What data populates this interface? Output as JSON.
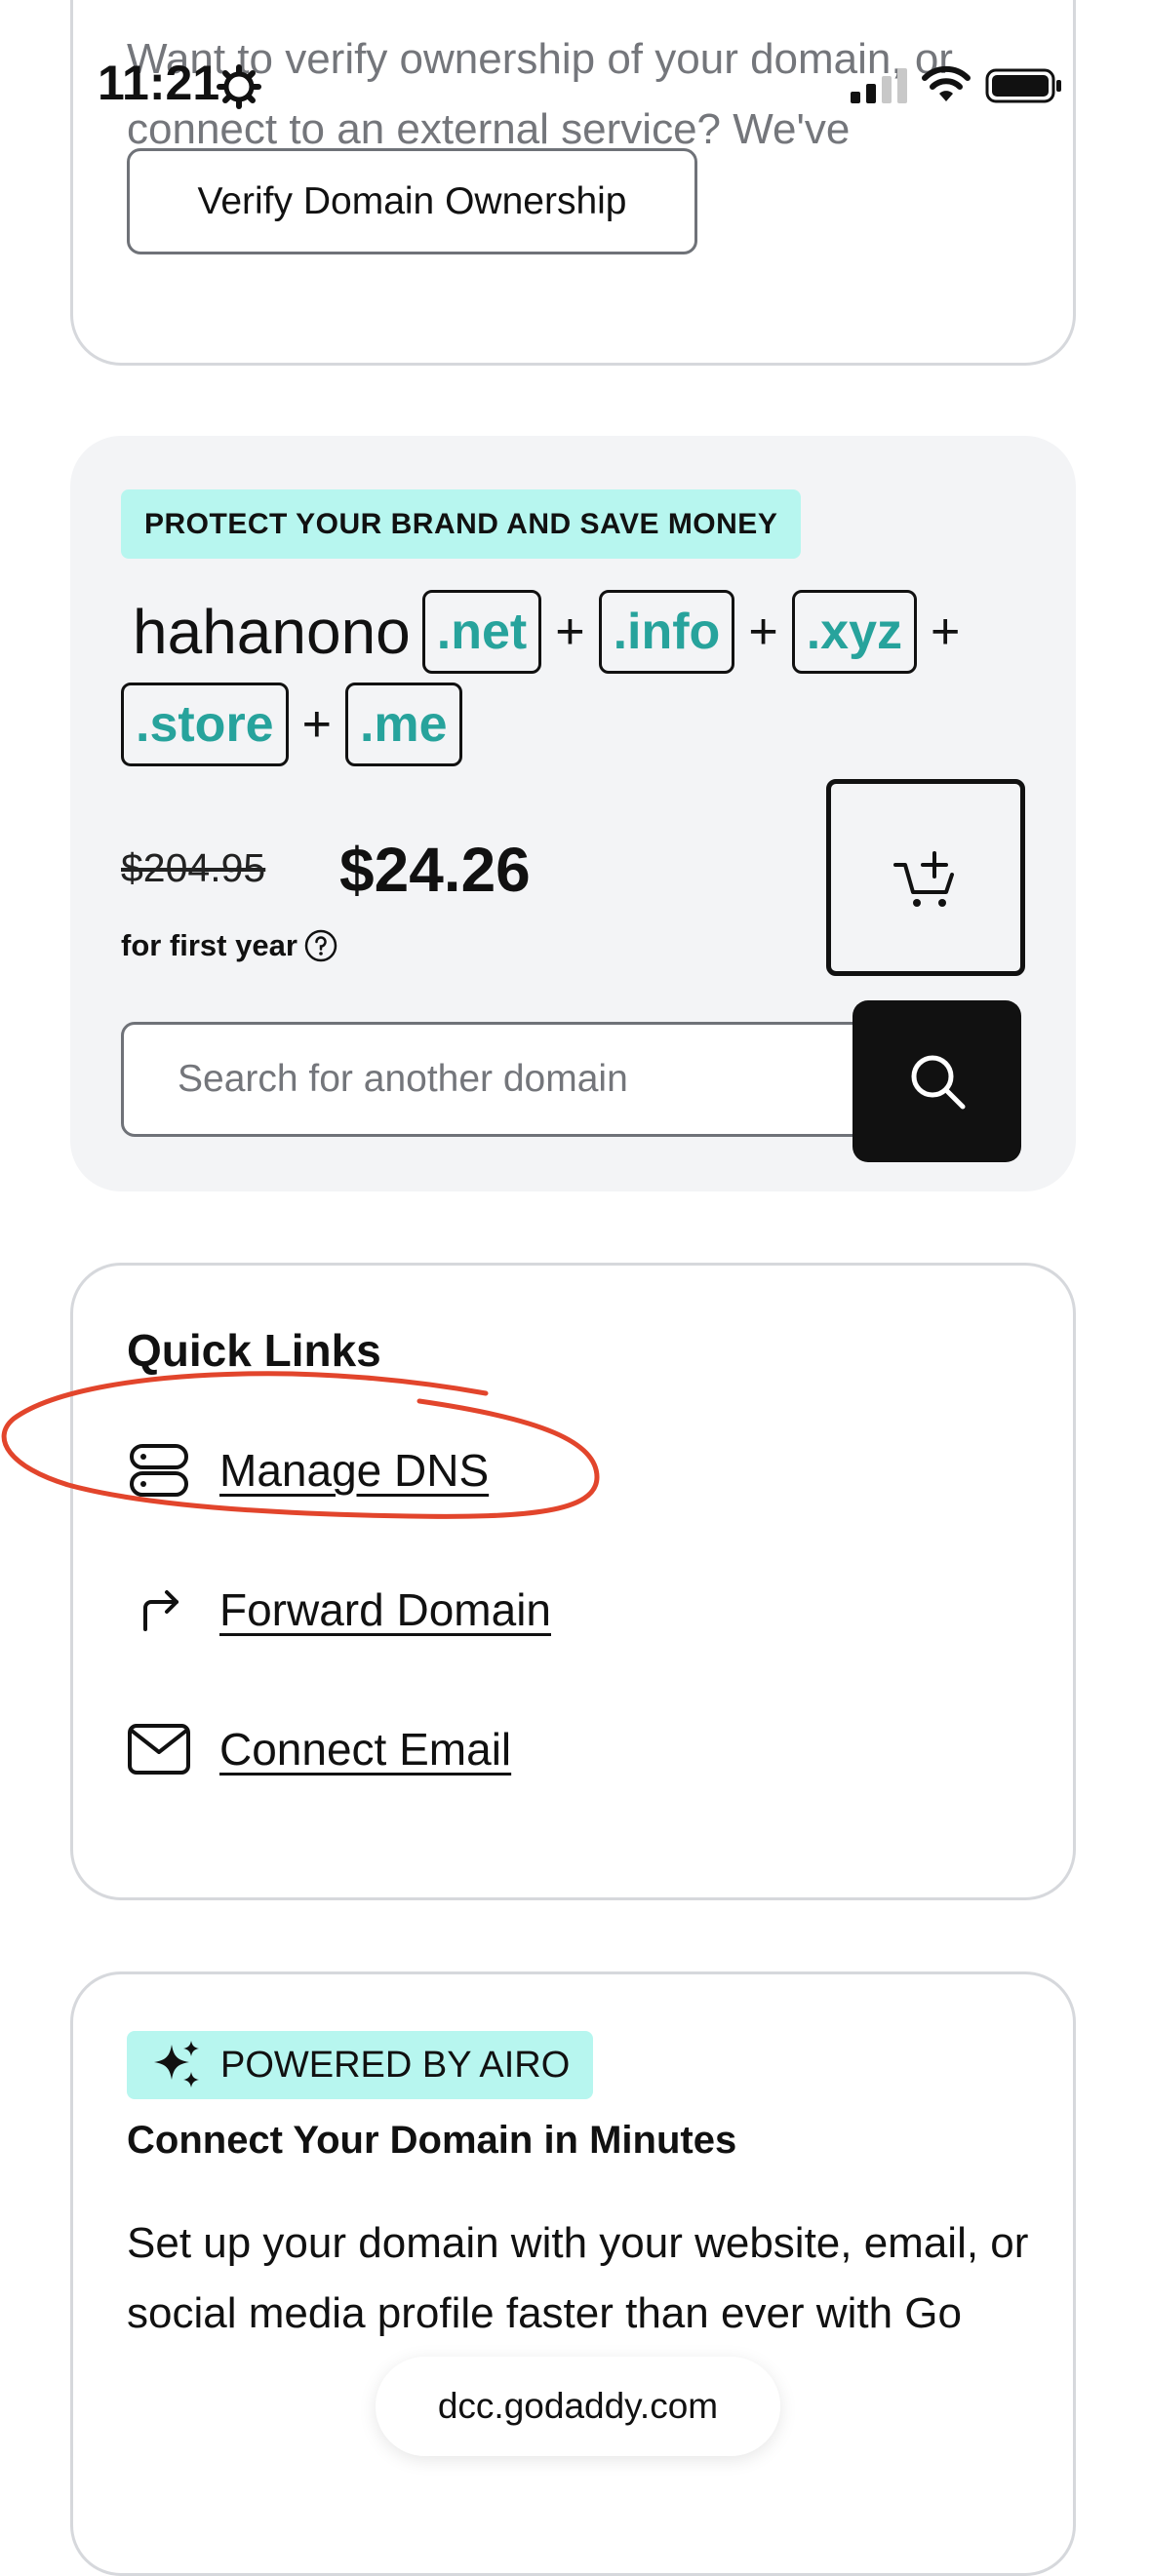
{
  "status_bar": {
    "time": "11:21",
    "icons": [
      "gear-icon",
      "cellular-signal-icon",
      "wifi-icon",
      "battery-icon"
    ]
  },
  "verify_card": {
    "description": "Want to verify ownership of your domain, or connect to an external service? We've made it easier than ever.",
    "button_label": "Verify Domain Ownership"
  },
  "protect_card": {
    "badge": "PROTECT YOUR BRAND AND SAVE MONEY",
    "domain_name": "hahanono",
    "tlds": [
      ".net",
      ".info",
      ".xyz",
      ".store",
      ".me"
    ],
    "plus": "+",
    "old_price": "$204.95",
    "new_price": "$24.26",
    "price_note": "for first year",
    "search": {
      "placeholder": "Search for another domain"
    },
    "icons": [
      "help-icon",
      "add-to-cart-icon",
      "search-icon"
    ]
  },
  "quick_links": {
    "title": "Quick Links",
    "items": [
      {
        "label": "Manage DNS",
        "icon": "dns-server-icon"
      },
      {
        "label": "Forward Domain",
        "icon": "forward-arrow-icon"
      },
      {
        "label": "Connect Email",
        "icon": "mail-icon"
      }
    ]
  },
  "airo_card": {
    "badge": "POWERED BY AIRO",
    "title": "Connect Your Domain in Minutes",
    "description": "Set up your domain with your website, email, or social media profile faster than ever with Go"
  },
  "browser": {
    "url": "dcc.godaddy.com"
  },
  "colors": {
    "accent_teal": "#27a39c",
    "badge_bg": "#b7f6ef",
    "annotation_red": "#e2452c",
    "panel_gray": "#f3f4f6"
  }
}
